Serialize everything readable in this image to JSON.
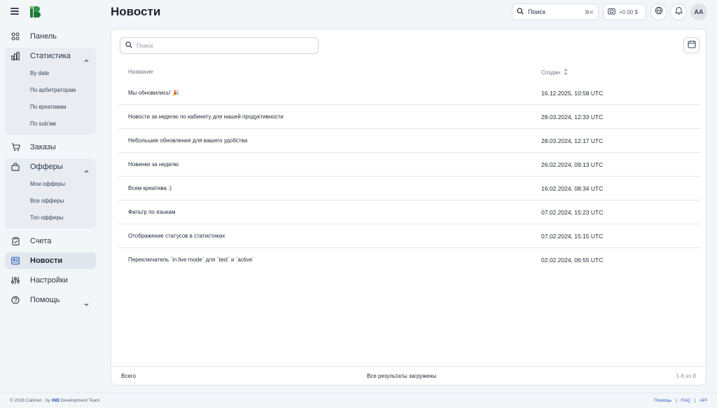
{
  "header": {
    "title": "Новости",
    "search_label": "Поиск",
    "search_shortcut": "⌘K",
    "balance": "+0.00 $",
    "avatar_initials": "AA"
  },
  "sidebar": {
    "items": [
      {
        "label": "Панель",
        "icon": "grid-icon"
      },
      {
        "label": "Статистика",
        "icon": "chart-icon",
        "sub": [
          "By date",
          "По арбитраторам",
          "По креативам",
          "По sub'ам"
        ]
      },
      {
        "label": "Заказы",
        "icon": "cart-icon"
      },
      {
        "label": "Офферы",
        "icon": "bag-icon",
        "sub": [
          "Мои офферы",
          "Все офферы",
          "Топ офферы"
        ]
      },
      {
        "label": "Счета",
        "icon": "clipboard-icon"
      },
      {
        "label": "Новости",
        "icon": "newspaper-icon",
        "active": true
      },
      {
        "label": "Настройки",
        "icon": "sliders-icon"
      },
      {
        "label": "Помощь",
        "icon": "help-icon"
      }
    ]
  },
  "main": {
    "search_placeholder": "Поиск",
    "columns": {
      "name": "Название",
      "created": "Создан"
    },
    "rows": [
      {
        "name": "Мы обновились! 🎉",
        "created": "16.12.2025, 10:58 UTC"
      },
      {
        "name": "Новости за неделю по кабинету для нашей продуктивности",
        "created": "28.03.2024, 12:33 UTC"
      },
      {
        "name": "Небольшие обновления для вашего удобства",
        "created": "28.03.2024, 12:17 UTC"
      },
      {
        "name": "Новинки за неделю",
        "created": "26.02.2024, 09:13 UTC"
      },
      {
        "name": "Всем креатива :)",
        "created": "16.02.2024, 08:34 UTC"
      },
      {
        "name": "Фильтр по языкам",
        "created": "07.02.2024, 15:23 UTC"
      },
      {
        "name": "Отображение статусов в статистиках",
        "created": "07.02.2024, 15:15 UTC"
      },
      {
        "name": "Переключатель `in live mode` для `test` и `active`",
        "created": "02.02.2024, 06:55 UTC"
      }
    ],
    "footer": {
      "total": "Всего",
      "loaded": "Все результаты загружены",
      "range": "1-8 из 8"
    }
  },
  "bottom": {
    "copyright_prefix": "© 2026 Cabinet · by ",
    "copyright_brand": "INB",
    "copyright_suffix": " Development Team",
    "links": [
      "Помощь",
      "FAQ",
      "API"
    ]
  },
  "colors": {
    "brand_green": "#1f7a3a",
    "link_blue": "#2e5bbf",
    "active_bg": "#e2e7ed"
  }
}
